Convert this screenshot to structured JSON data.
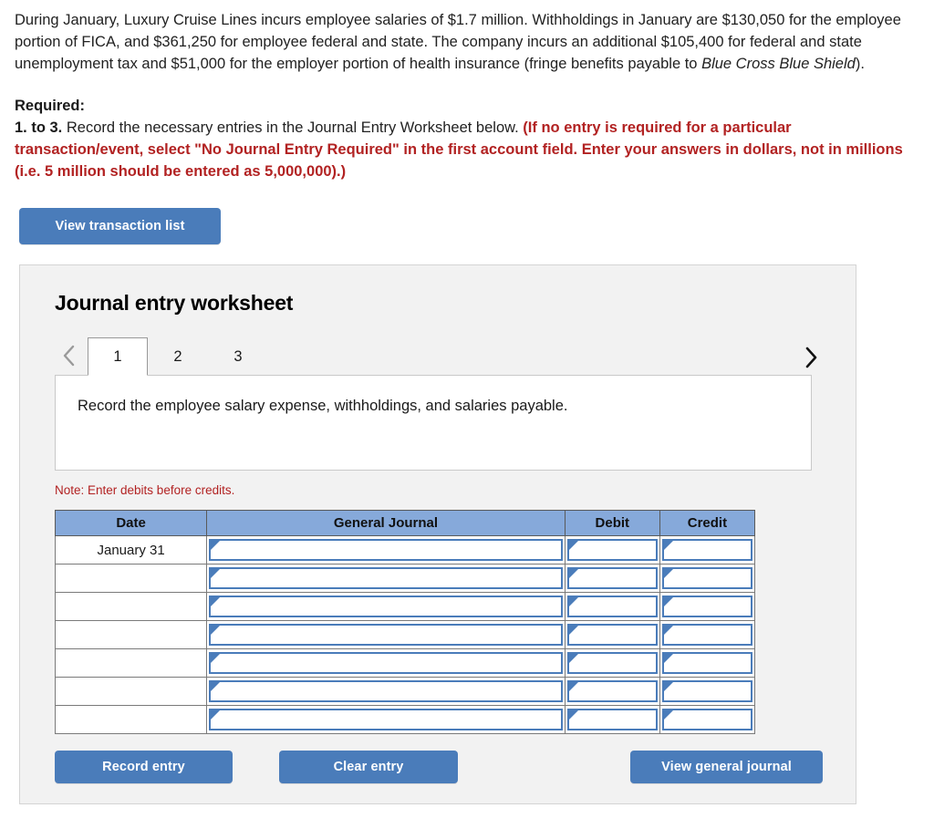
{
  "problem": {
    "text_part1": "During January, Luxury Cruise Lines incurs employee salaries of $1.7 million. Withholdings in January are $130,050 for the employee portion of FICA, and $361,250 for employee federal and state. The company incurs an additional $105,400 for federal and state unemployment tax and $51,000 for the employer portion of health insurance (fringe benefits payable to ",
    "text_italic": "Blue Cross Blue Shield",
    "text_part2": ")."
  },
  "required": {
    "label": "Required:",
    "number": "1. to 3.",
    "body": " Record the necessary entries in the Journal Entry Worksheet below. ",
    "red": "(If no entry is required for a particular transaction/event, select \"No Journal Entry Required\" in the first account field. Enter your answers in dollars, not in millions (i.e. 5 million should be entered as 5,000,000).)"
  },
  "view_transaction_button": "View transaction list",
  "worksheet": {
    "title": "Journal entry worksheet",
    "prev_arrow_icon": "chevron-left-icon",
    "next_arrow_icon": "chevron-right-icon",
    "tabs": [
      {
        "label": "1",
        "active": true
      },
      {
        "label": "2",
        "active": false
      },
      {
        "label": "3",
        "active": false
      }
    ],
    "instruction": "Record the employee salary expense, withholdings, and salaries payable.",
    "note": "Note: Enter debits before credits.",
    "table": {
      "headers": [
        "Date",
        "General Journal",
        "Debit",
        "Credit"
      ],
      "rows": [
        {
          "date": "January 31",
          "general_journal": "",
          "debit": "",
          "credit": ""
        },
        {
          "date": "",
          "general_journal": "",
          "debit": "",
          "credit": ""
        },
        {
          "date": "",
          "general_journal": "",
          "debit": "",
          "credit": ""
        },
        {
          "date": "",
          "general_journal": "",
          "debit": "",
          "credit": ""
        },
        {
          "date": "",
          "general_journal": "",
          "debit": "",
          "credit": ""
        },
        {
          "date": "",
          "general_journal": "",
          "debit": "",
          "credit": ""
        },
        {
          "date": "",
          "general_journal": "",
          "debit": "",
          "credit": ""
        }
      ]
    },
    "actions": {
      "record_entry": "Record entry",
      "clear_entry": "Clear entry",
      "view_general_journal": "View general journal"
    }
  },
  "colors": {
    "button_blue": "#4a7cba",
    "table_header_blue": "#86a9da",
    "red_text": "#b22222",
    "panel_bg": "#f2f2f2"
  }
}
